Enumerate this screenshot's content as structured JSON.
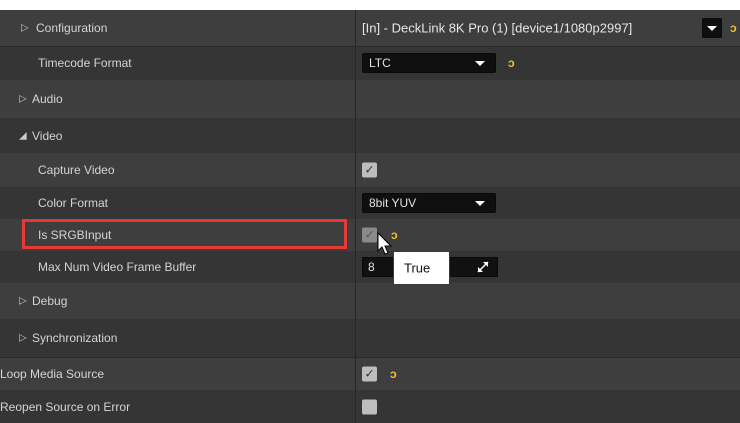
{
  "rows": {
    "configuration": {
      "label": "Configuration",
      "value": "[In] - DeckLink 8K Pro (1) [device1/1080p2997]"
    },
    "timecode_format": {
      "label": "Timecode Format",
      "value": "LTC"
    },
    "audio": {
      "label": "Audio"
    },
    "video": {
      "label": "Video"
    },
    "capture_video": {
      "label": "Capture Video"
    },
    "color_format": {
      "label": "Color Format",
      "value": "8bit YUV"
    },
    "is_srgb_input": {
      "label": "Is SRGBInput"
    },
    "max_num_video_frame_buffer": {
      "label": "Max Num Video Frame Buffer",
      "value": "8"
    },
    "debug": {
      "label": "Debug"
    },
    "synchronization": {
      "label": "Synchronization"
    },
    "loop_media_source": {
      "label": "Loop Media Source"
    },
    "reopen_source_on_error": {
      "label": "Reopen Source on Error"
    }
  },
  "tooltip": {
    "text": "True"
  },
  "glyphs": {
    "collapsed": "▷",
    "expanded": "◢",
    "check": "✓",
    "reset": "ↄ"
  },
  "colors": {
    "highlight": "#e53935",
    "reset_arrow": "#f1c232"
  }
}
